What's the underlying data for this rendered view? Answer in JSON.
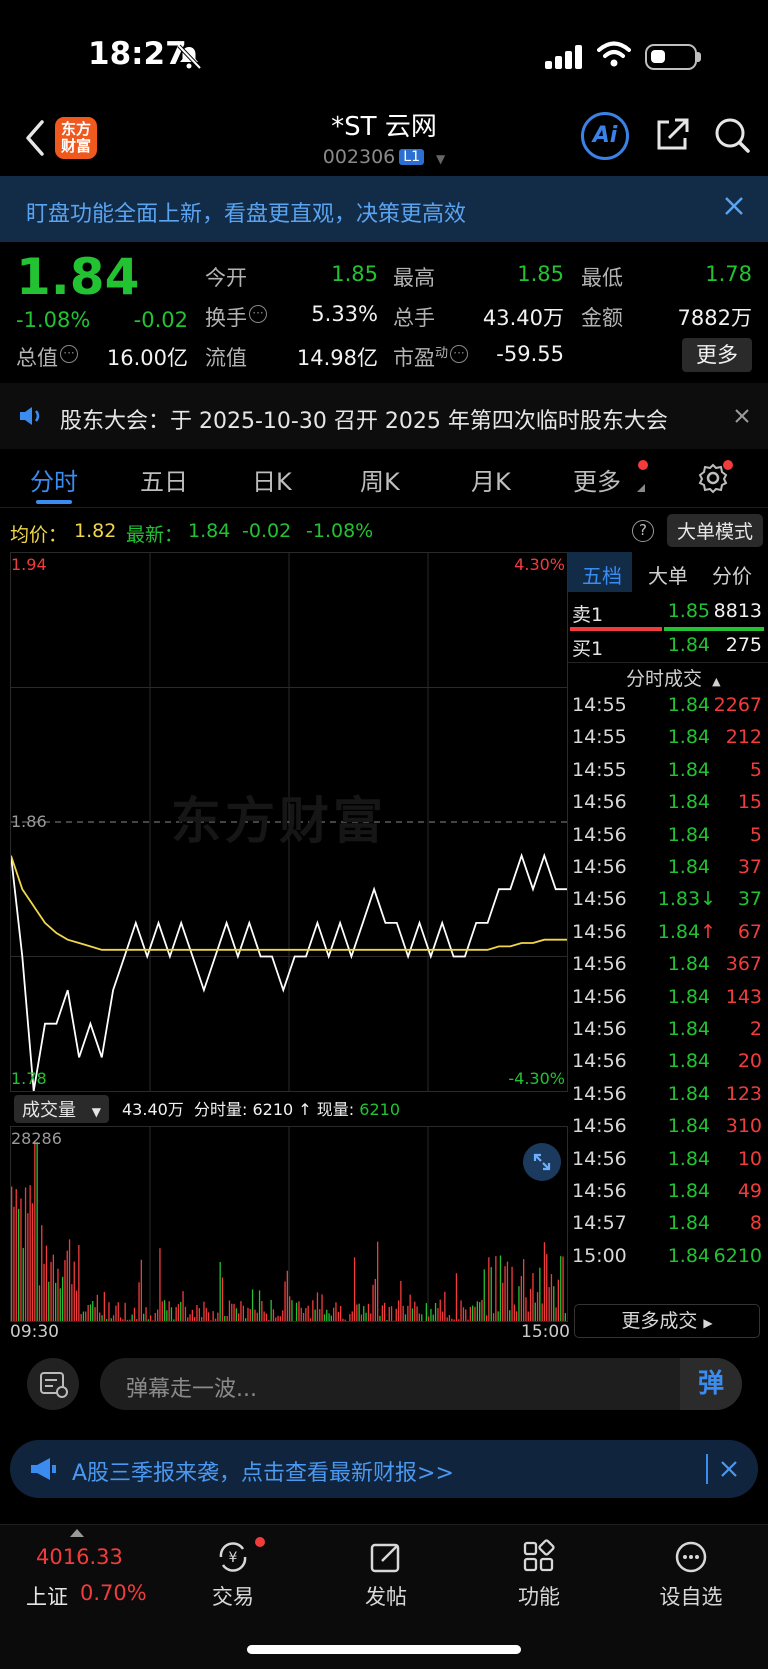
{
  "status_bar": {
    "time": "18:27"
  },
  "header": {
    "logo_text": "东方财富",
    "stock_name": "*ST 云网",
    "stock_code": "002306",
    "level_badge": "L1",
    "ai_label": "Ai"
  },
  "notice": {
    "text": "盯盘功能全面上新，看盘更直观，决策更高效"
  },
  "quote": {
    "price": "1.84",
    "change_pct": "-1.08%",
    "change": "-0.02",
    "fields": [
      {
        "label": "今开",
        "value": "1.85",
        "color": "green"
      },
      {
        "label": "最高",
        "value": "1.85",
        "color": "green"
      },
      {
        "label": "最低",
        "value": "1.78",
        "color": "green"
      },
      {
        "label": "换手",
        "value": "5.33%",
        "color": "white"
      },
      {
        "label": "总手",
        "value": "43.40万",
        "color": "white"
      },
      {
        "label": "金额",
        "value": "7882万",
        "color": "white"
      },
      {
        "label": "总值",
        "value": "16.00亿",
        "color": "white"
      },
      {
        "label": "流值",
        "value": "14.98亿",
        "color": "white"
      },
      {
        "label": "市盈",
        "label_sup": "动",
        "value": "-59.55",
        "color": "white"
      }
    ],
    "more_button": "更多"
  },
  "announcement": {
    "text": "股东大会：于 2025-10-30 召开 2025 年第四次临时股东大会"
  },
  "tabs": [
    "分时",
    "五日",
    "日K",
    "周K",
    "月K",
    "更多"
  ],
  "info_row": {
    "avg_label": "均价：",
    "avg_value": "1.82",
    "latest_label": "最新：",
    "latest_value": "1.84",
    "latest_change": "-0.02",
    "latest_pct": "-1.08%",
    "mode_button": "大单模式"
  },
  "chart": {
    "y_top": "1.94",
    "y_mid": "1.86",
    "y_bottom": "1.78",
    "pct_top": "4.30%",
    "pct_bottom": "-4.30%",
    "x_start": "09:30",
    "x_end": "15:00",
    "watermark": "东方财富",
    "volume_select": "成交量",
    "volume_total": "43.40万",
    "minute_vol_label": "分时量:",
    "minute_vol": "6210",
    "current_vol_label": "现量:",
    "current_vol": "6210",
    "vol_max": "28286"
  },
  "chart_data": {
    "type": "line",
    "title": "",
    "xlabel": "",
    "ylabel": "",
    "ylim": [
      1.78,
      1.94
    ],
    "reference_price": 1.86,
    "x_range": [
      "09:30",
      "15:00"
    ],
    "series": [
      {
        "name": "最新",
        "values": [
          1.85,
          1.82,
          1.78,
          1.8,
          1.8,
          1.81,
          1.79,
          1.8,
          1.79,
          1.81,
          1.82,
          1.83,
          1.82,
          1.83,
          1.82,
          1.83,
          1.82,
          1.81,
          1.82,
          1.83,
          1.82,
          1.83,
          1.82,
          1.82,
          1.81,
          1.82,
          1.82,
          1.83,
          1.82,
          1.83,
          1.82,
          1.83,
          1.84,
          1.83,
          1.83,
          1.82,
          1.83,
          1.82,
          1.83,
          1.82,
          1.82,
          1.83,
          1.83,
          1.84,
          1.84,
          1.85,
          1.84,
          1.85,
          1.84,
          1.84
        ]
      },
      {
        "name": "均价",
        "values": [
          1.85,
          1.84,
          1.835,
          1.83,
          1.827,
          1.825,
          1.824,
          1.823,
          1.822,
          1.822,
          1.822,
          1.822,
          1.822,
          1.822,
          1.822,
          1.822,
          1.822,
          1.822,
          1.822,
          1.822,
          1.822,
          1.822,
          1.822,
          1.822,
          1.822,
          1.822,
          1.822,
          1.822,
          1.822,
          1.822,
          1.822,
          1.822,
          1.822,
          1.822,
          1.822,
          1.822,
          1.822,
          1.822,
          1.822,
          1.822,
          1.822,
          1.822,
          1.822,
          1.823,
          1.823,
          1.824,
          1.824,
          1.825,
          1.825,
          1.825
        ]
      }
    ]
  },
  "right_panel": {
    "tabs": [
      "五档",
      "大单",
      "分价"
    ],
    "sell1": {
      "label": "卖1",
      "price": "1.85",
      "vol": "8813"
    },
    "buy1": {
      "label": "买1",
      "price": "1.84",
      "vol": "275"
    },
    "trades_title": "分时成交",
    "trades": [
      {
        "time": "14:55",
        "price": "1.84",
        "vol": "2267",
        "pc": "green",
        "vc": "red",
        "arrow": ""
      },
      {
        "time": "14:55",
        "price": "1.84",
        "vol": "212",
        "pc": "green",
        "vc": "red",
        "arrow": ""
      },
      {
        "time": "14:55",
        "price": "1.84",
        "vol": "5",
        "pc": "green",
        "vc": "red",
        "arrow": ""
      },
      {
        "time": "14:56",
        "price": "1.84",
        "vol": "15",
        "pc": "green",
        "vc": "red",
        "arrow": ""
      },
      {
        "time": "14:56",
        "price": "1.84",
        "vol": "5",
        "pc": "green",
        "vc": "red",
        "arrow": ""
      },
      {
        "time": "14:56",
        "price": "1.84",
        "vol": "37",
        "pc": "green",
        "vc": "red",
        "arrow": ""
      },
      {
        "time": "14:56",
        "price": "1.83",
        "vol": "37",
        "pc": "green",
        "vc": "green",
        "arrow": "↓"
      },
      {
        "time": "14:56",
        "price": "1.84",
        "vol": "67",
        "pc": "green",
        "vc": "red",
        "arrow": "↑"
      },
      {
        "time": "14:56",
        "price": "1.84",
        "vol": "367",
        "pc": "green",
        "vc": "red",
        "arrow": ""
      },
      {
        "time": "14:56",
        "price": "1.84",
        "vol": "143",
        "pc": "green",
        "vc": "red",
        "arrow": ""
      },
      {
        "time": "14:56",
        "price": "1.84",
        "vol": "2",
        "pc": "green",
        "vc": "red",
        "arrow": ""
      },
      {
        "time": "14:56",
        "price": "1.84",
        "vol": "20",
        "pc": "green",
        "vc": "red",
        "arrow": ""
      },
      {
        "time": "14:56",
        "price": "1.84",
        "vol": "123",
        "pc": "green",
        "vc": "red",
        "arrow": ""
      },
      {
        "time": "14:56",
        "price": "1.84",
        "vol": "310",
        "pc": "green",
        "vc": "red",
        "arrow": ""
      },
      {
        "time": "14:56",
        "price": "1.84",
        "vol": "10",
        "pc": "green",
        "vc": "red",
        "arrow": ""
      },
      {
        "time": "14:56",
        "price": "1.84",
        "vol": "49",
        "pc": "green",
        "vc": "red",
        "arrow": ""
      },
      {
        "time": "14:57",
        "price": "1.84",
        "vol": "8",
        "pc": "green",
        "vc": "red",
        "arrow": ""
      },
      {
        "time": "15:00",
        "price": "1.84",
        "vol": "6210",
        "pc": "green",
        "vc": "green",
        "arrow": ""
      }
    ],
    "more_trades": "更多成交"
  },
  "danmu": {
    "placeholder": "弹幕走一波...",
    "send": "弹"
  },
  "promo": {
    "text": "A股三季报来袭，点击查看最新财报>>"
  },
  "bottom_nav": {
    "index_value": "4016.33",
    "index_name": "上证",
    "index_pct": "0.70%",
    "items": [
      "交易",
      "发帖",
      "功能",
      "设自选"
    ]
  },
  "colors": {
    "up": "#f23c3c",
    "down": "#22c232",
    "accent": "#3b8cf0",
    "avg_line": "#f0d64a"
  }
}
